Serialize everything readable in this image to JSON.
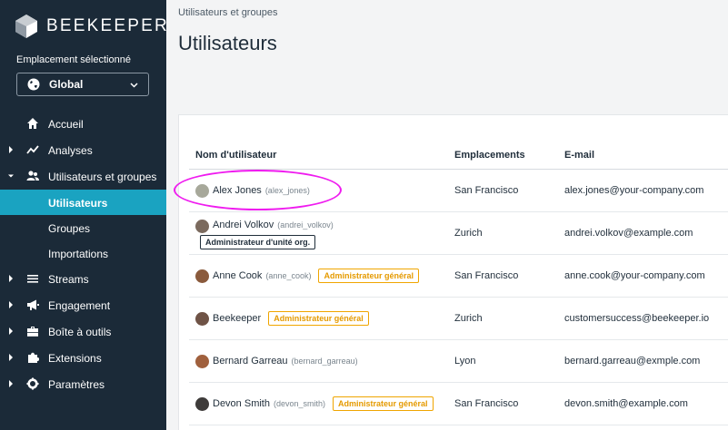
{
  "brand": {
    "name": "BEEKEEPER"
  },
  "location": {
    "label": "Emplacement sélectionné",
    "selected": "Global"
  },
  "nav": {
    "accueil": "Accueil",
    "analyses": "Analyses",
    "users_groups": "Utilisateurs et groupes",
    "sub": {
      "utilisateurs": "Utilisateurs",
      "groupes": "Groupes",
      "importations": "Importations"
    },
    "streams": "Streams",
    "engagement": "Engagement",
    "boite": "Boîte à outils",
    "extensions": "Extensions",
    "parametres": "Paramètres"
  },
  "breadcrumb": "Utilisateurs et groupes",
  "page_title": "Utilisateurs",
  "table": {
    "headers": {
      "name": "Nom d'utilisateur",
      "locations": "Emplacements",
      "email": "E-mail"
    },
    "rows": [
      {
        "name": "Alex Jones",
        "handle": "(alex_jones)",
        "badge": "",
        "location": "San Francisco",
        "email": "alex.jones@your-company.com"
      },
      {
        "name": "Andrei Volkov",
        "handle": "(andrei_volkov)",
        "badge": "Administrateur d'unité org.",
        "location": "Zurich",
        "email": "andrei.volkov@example.com"
      },
      {
        "name": "Anne Cook",
        "handle": "(anne_cook)",
        "badge": "Administrateur général",
        "location": "San Francisco",
        "email": "anne.cook@your-company.com"
      },
      {
        "name": "Beekeeper",
        "handle": "",
        "badge": "Administrateur général",
        "location": "Zurich",
        "email": "customersuccess@beekeeper.io"
      },
      {
        "name": "Bernard Garreau",
        "handle": "(bernard_garreau)",
        "badge": "",
        "location": "Lyon",
        "email": "bernard.garreau@exmple.com"
      },
      {
        "name": "Devon Smith",
        "handle": "(devon_smith)",
        "badge": "Administrateur général",
        "location": "San Francisco",
        "email": "devon.smith@example.com"
      }
    ]
  },
  "colors": {
    "sidebar": "#1b2a38",
    "active": "#1aa3c1",
    "badge": "#f0a500",
    "highlight": "#ef1bef"
  }
}
